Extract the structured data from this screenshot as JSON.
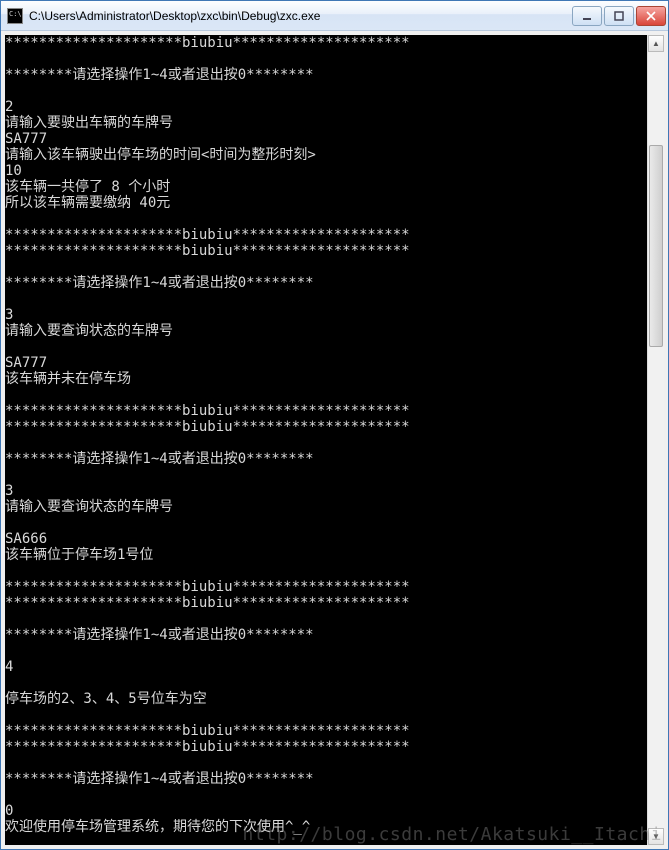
{
  "window": {
    "title": "C:\\Users\\Administrator\\Desktop\\zxc\\bin\\Debug\\zxc.exe"
  },
  "console": {
    "lines": [
      "*********************biubiu*********************",
      "",
      "********请选择操作1~4或者退出按0********",
      "",
      "2",
      "请输入要驶出车辆的车牌号",
      "SA777",
      "请输入该车辆驶出停车场的时间<时间为整形时刻>",
      "10",
      "该车辆一共停了 8 个小时",
      "所以该车辆需要缴纳 40元",
      "",
      "*********************biubiu*********************",
      "*********************biubiu*********************",
      "",
      "********请选择操作1~4或者退出按0********",
      "",
      "3",
      "请输入要查询状态的车牌号",
      "",
      "SA777",
      "该车辆并未在停车场",
      "",
      "*********************biubiu*********************",
      "*********************biubiu*********************",
      "",
      "********请选择操作1~4或者退出按0********",
      "",
      "3",
      "请输入要查询状态的车牌号",
      "",
      "SA666",
      "该车辆位于停车场1号位",
      "",
      "*********************biubiu*********************",
      "*********************biubiu*********************",
      "",
      "********请选择操作1~4或者退出按0********",
      "",
      "4",
      "",
      "停车场的2、3、4、5号位车为空",
      "",
      "*********************biubiu*********************",
      "*********************biubiu*********************",
      "",
      "********请选择操作1~4或者退出按0********",
      "",
      "0",
      "欢迎使用停车场管理系统，期待您的下次使用^_^"
    ]
  },
  "watermark": "http://blog.csdn.net/Akatsuki__Itachi"
}
